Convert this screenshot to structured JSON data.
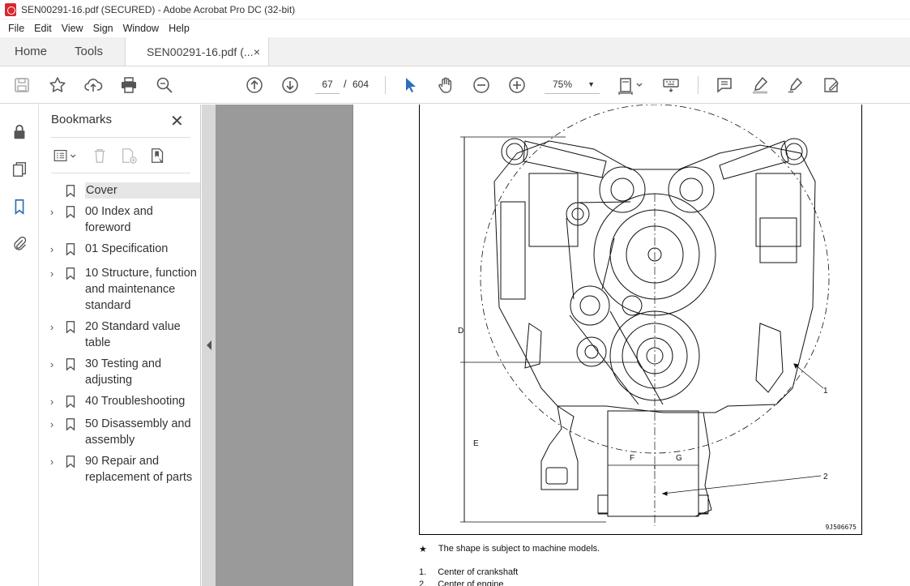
{
  "window": {
    "title": "SEN00291-16.pdf (SECURED) - Adobe Acrobat Pro DC (32-bit)"
  },
  "menu": [
    "File",
    "Edit",
    "View",
    "Sign",
    "Window",
    "Help"
  ],
  "tabs": {
    "home": "Home",
    "tools": "Tools",
    "document": "SEN00291-16.pdf (...",
    "close": "×"
  },
  "toolbar": {
    "current_page": "67",
    "page_separator": "/",
    "total_pages": "604",
    "zoom": "75%"
  },
  "bookmarks": {
    "title": "Bookmarks",
    "close": "✕",
    "items": [
      {
        "label": "Cover",
        "expandable": false,
        "selected": true
      },
      {
        "label": "00 Index and foreword",
        "expandable": true
      },
      {
        "label": "01 Specification",
        "expandable": true
      },
      {
        "label": "10 Structure, function and maintenance standard",
        "expandable": true
      },
      {
        "label": "20 Standard value table",
        "expandable": true
      },
      {
        "label": "30 Testing and adjusting",
        "expandable": true
      },
      {
        "label": "40 Troubleshooting",
        "expandable": true
      },
      {
        "label": "50 Disassembly and assembly",
        "expandable": true
      },
      {
        "label": "90 Repair and replacement of parts",
        "expandable": true
      }
    ]
  },
  "page": {
    "figure_labels": {
      "d": "D",
      "e": "E",
      "f": "F",
      "g": "G",
      "one": "1",
      "two": "2"
    },
    "figure_id": "9J506675",
    "note_marker": "★",
    "note": "The shape is subject to machine models.",
    "list": [
      {
        "num": "1.",
        "text": "Center of crankshaft"
      },
      {
        "num": "2.",
        "text": "Center of engine"
      }
    ]
  },
  "colors": {
    "accent": "#2c6fbb",
    "doc_background": "#9a9a9a",
    "app_icon": "#d9272e"
  }
}
